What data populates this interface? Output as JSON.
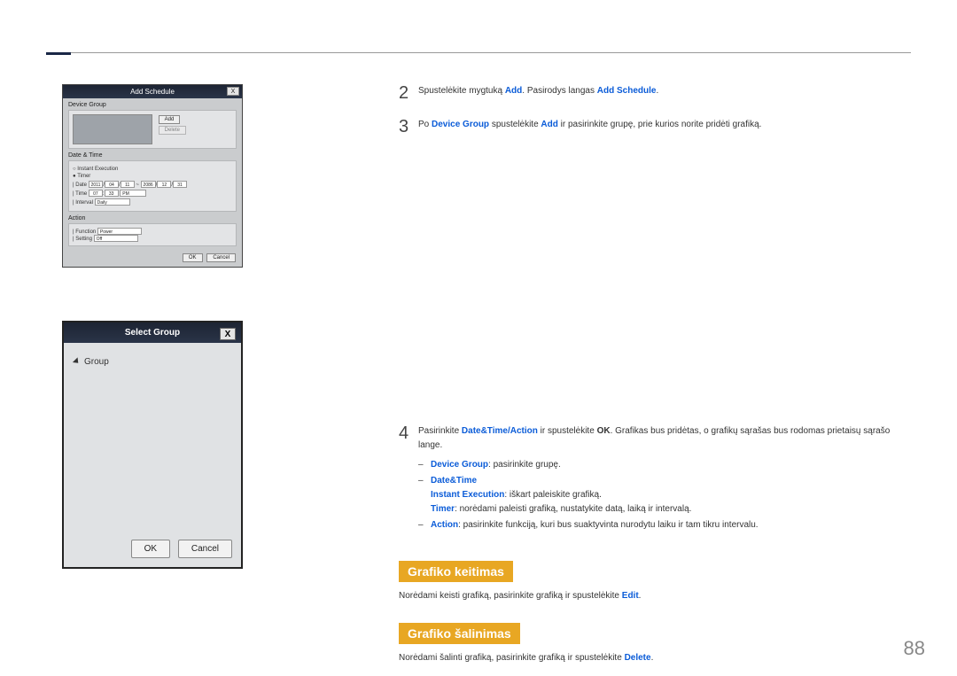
{
  "pageNumber": "88",
  "dialogA": {
    "title": "Add Schedule",
    "sections": {
      "deviceGroup": "Device Group",
      "dateTime": "Date & Time",
      "action": "Action"
    },
    "buttons": {
      "add": "Add",
      "delete": "Delete",
      "ok": "OK",
      "cancel": "Cancel"
    },
    "dt": {
      "instant": "Instant Execution",
      "timer": "Timer",
      "dateLabel": "Date",
      "timeLabel": "Time",
      "intervalLabel": "Interval",
      "year1": "2011",
      "mon1": "04",
      "day1": "11",
      "year2": "2086",
      "mon2": "12",
      "day2": "31",
      "hour": "07",
      "min": "33",
      "ampm": "PM",
      "interval": "Daily"
    },
    "actionRow": {
      "functionLabel": "Function",
      "functionVal": "Power",
      "settingLabel": "Setting",
      "settingVal": "Off"
    }
  },
  "dialogB": {
    "title": "Select Group",
    "groupLabel": "Group",
    "ok": "OK",
    "cancel": "Cancel"
  },
  "steps": {
    "s2": {
      "num": "2",
      "pre": "Spustelėkite mygtuką ",
      "add": "Add",
      "mid": ". Pasirodys langas ",
      "addSchedule": "Add Schedule",
      "post": "."
    },
    "s3": {
      "num": "3",
      "pre": "Po ",
      "dg": "Device Group",
      "mid1": " spustelėkite ",
      "add": "Add",
      "post": " ir pasirinkite grupę, prie kurios norite pridėti grafiką."
    },
    "s4": {
      "num": "4",
      "pre": "Pasirinkite ",
      "dta": "Date&Time/Action",
      "mid1": " ir spustelėkite ",
      "ok": "OK",
      "post": ". Grafikas bus pridėtas, o grafikų sąrašas bus rodomas prietaisų sąrašo lange.",
      "bullets": {
        "b1_label": "Device Group",
        "b1_text": ": pasirinkite grupę.",
        "b2_label": "Date&Time",
        "b2_instant_label": "Instant Execution",
        "b2_instant_text": ": iškart paleiskite grafiką.",
        "b2_timer_label": "Timer",
        "b2_timer_text": ": norėdami paleisti grafiką, nustatykite datą, laiką ir intervalą.",
        "b3_label": "Action",
        "b3_text": ": pasirinkite funkciją, kuri bus suaktyvinta nurodytu laiku ir tam tikru intervalu."
      }
    }
  },
  "headings": {
    "h1": "Grafiko keitimas",
    "h1_body_pre": "Norėdami keisti grafiką, pasirinkite grafiką ir spustelėkite ",
    "h1_body_link": "Edit",
    "h1_body_post": ".",
    "h2": "Grafiko šalinimas",
    "h2_body_pre": "Norėdami šalinti grafiką, pasirinkite grafiką ir spustelėkite ",
    "h2_body_link": "Delete",
    "h2_body_post": "."
  }
}
